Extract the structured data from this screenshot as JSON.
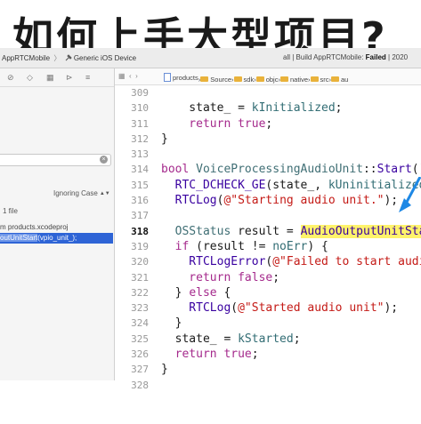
{
  "headline": "如何上手大型项目?",
  "toolbar": {
    "scheme": "AppRTCMobile",
    "device": "Generic iOS Device",
    "status_prefix": "all | Build AppRTCMobile:",
    "status_result": "Failed",
    "status_suffix": "| 2020"
  },
  "navigator": {
    "case_option": "Ignoring Case",
    "result_count": "1 file",
    "file_result": "m products.xcodeproj",
    "match_highlight": "outUnitStart",
    "match_rest": "(vpio_unit_);"
  },
  "jumpbar": {
    "crumbs": [
      "products",
      "Source",
      "sdk",
      "objc",
      "native",
      "src",
      "au"
    ]
  },
  "code": {
    "lines": [
      {
        "n": "309",
        "html": ""
      },
      {
        "n": "310",
        "html": "<span class=\"tx\">    state_ = </span><span class=\"id\">kInitialized</span><span class=\"tx\">;</span>"
      },
      {
        "n": "311",
        "html": "<span class=\"kw\">    return true</span><span class=\"tx\">;</span>"
      },
      {
        "n": "312",
        "html": "<span class=\"tx\">}</span>"
      },
      {
        "n": "313",
        "html": ""
      },
      {
        "n": "314",
        "html": "<span class=\"kw\">bool </span><span class=\"ty\">VoiceProcessingAudioUnit</span><span class=\"tx\">::</span><span class=\"fn\">Start</span><span class=\"tx\">()</span>"
      },
      {
        "n": "315",
        "html": "<span class=\"fn\">  RTC_DCHECK_GE</span><span class=\"tx\">(state_, </span><span class=\"id\">kUninitialized</span>"
      },
      {
        "n": "316",
        "html": "<span class=\"fn\">  RTCLog</span><span class=\"tx\">(</span><span class=\"str\">@\"Starting audio unit.\"</span><span class=\"tx\">);</span>"
      },
      {
        "n": "317",
        "html": ""
      },
      {
        "n": "318",
        "html": "<span class=\"ty\">  OSStatus</span><span class=\"tx\"> result = </span><span class=\"fn hlw\">AudioOutputUnitStart</span>",
        "current": true
      },
      {
        "n": "319",
        "html": "<span class=\"kw\">  if </span><span class=\"tx\">(result != </span><span class=\"id\">noErr</span><span class=\"tx\">) {</span>"
      },
      {
        "n": "320",
        "html": "<span class=\"fn\">    RTCLogError</span><span class=\"tx\">(</span><span class=\"str\">@\"Failed to start audio</span>"
      },
      {
        "n": "321",
        "html": "<span class=\"kw\">    return false</span><span class=\"tx\">;</span>"
      },
      {
        "n": "322",
        "html": "<span class=\"tx\">  } </span><span class=\"kw\">else</span><span class=\"tx\"> {</span>"
      },
      {
        "n": "323",
        "html": "<span class=\"fn\">    RTCLog</span><span class=\"tx\">(</span><span class=\"str\">@\"Started audio unit\"</span><span class=\"tx\">);</span>"
      },
      {
        "n": "324",
        "html": "<span class=\"tx\">  }</span>"
      },
      {
        "n": "325",
        "html": "<span class=\"tx\">  state_ = </span><span class=\"id\">kStarted</span><span class=\"tx\">;</span>"
      },
      {
        "n": "326",
        "html": "<span class=\"kw\">  return true</span><span class=\"tx\">;</span>"
      },
      {
        "n": "327",
        "html": "<span class=\"tx\">}</span>"
      },
      {
        "n": "328",
        "html": ""
      }
    ]
  },
  "colors": {
    "keyword": "#a52a8c",
    "string": "#c41a16",
    "highlight": "#fff36b",
    "selection": "#2e64d6",
    "annotation_arrow": "#1e88e5"
  }
}
